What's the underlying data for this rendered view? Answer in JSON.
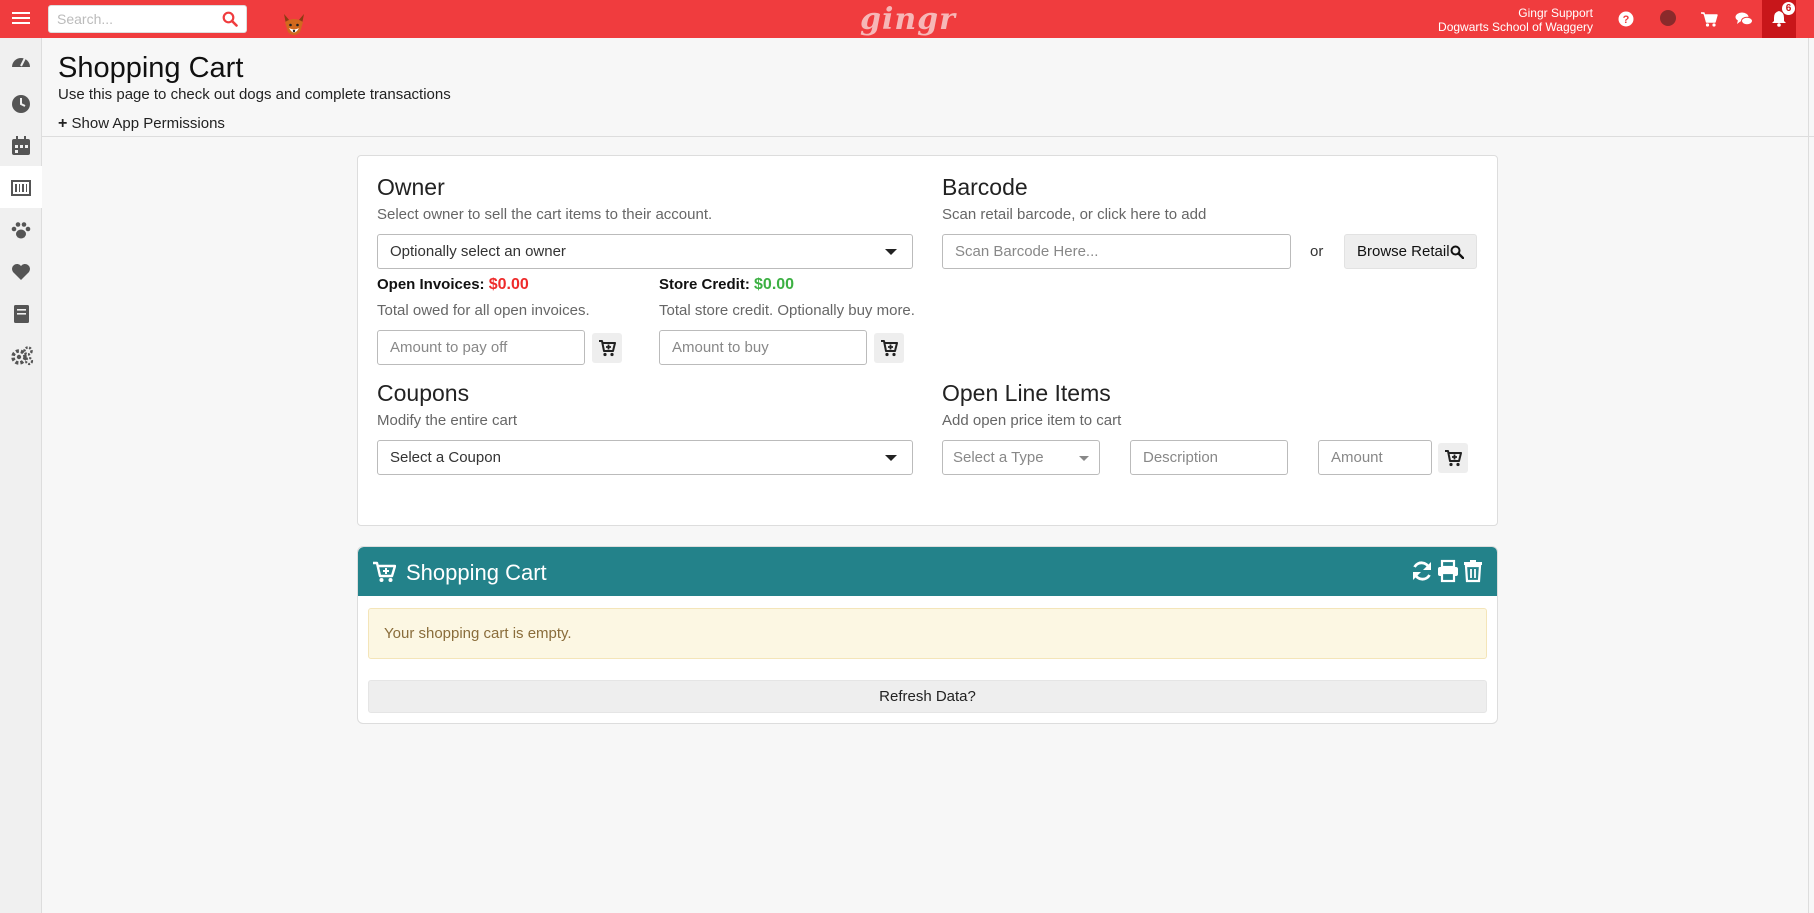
{
  "topbar": {
    "search_placeholder": "Search...",
    "logo": "gingr",
    "user_name": "Gingr Support",
    "business_name": "Dogwarts School of Waggery",
    "notification_count": "6"
  },
  "page": {
    "title": "Shopping Cart",
    "subtitle": "Use this page to check out dogs and complete transactions",
    "permissions_link": "Show App Permissions"
  },
  "owner": {
    "title": "Owner",
    "description": "Select owner to sell the cart items to their account.",
    "select_value": "Optionally select an owner",
    "open_invoices_label": "Open Invoices:",
    "open_invoices_value": "$0.00",
    "open_invoices_desc": "Total owed for all open invoices.",
    "payoff_placeholder": "Amount to pay off",
    "store_credit_label": "Store Credit:",
    "store_credit_value": "$0.00",
    "store_credit_desc": "Total store credit. Optionally buy more.",
    "buy_placeholder": "Amount to buy"
  },
  "barcode": {
    "title": "Barcode",
    "description": "Scan retail barcode, or click here to add",
    "placeholder": "Scan Barcode Here...",
    "or_text": "or",
    "browse_label": "Browse Retail"
  },
  "coupons": {
    "title": "Coupons",
    "description": "Modify the entire cart",
    "select_value": "Select a Coupon"
  },
  "open_line_items": {
    "title": "Open Line Items",
    "description": "Add open price item to cart",
    "type_select": "Select a Type",
    "description_placeholder": "Description",
    "amount_placeholder": "Amount"
  },
  "cart": {
    "title": "Shopping Cart",
    "empty_message": "Your shopping cart is empty.",
    "refresh_label": "Refresh Data?"
  },
  "colors": {
    "topbar": "#f03c3e",
    "cart_header": "#23828a",
    "negative": "#ee2b2b",
    "positive": "#3cb043"
  }
}
